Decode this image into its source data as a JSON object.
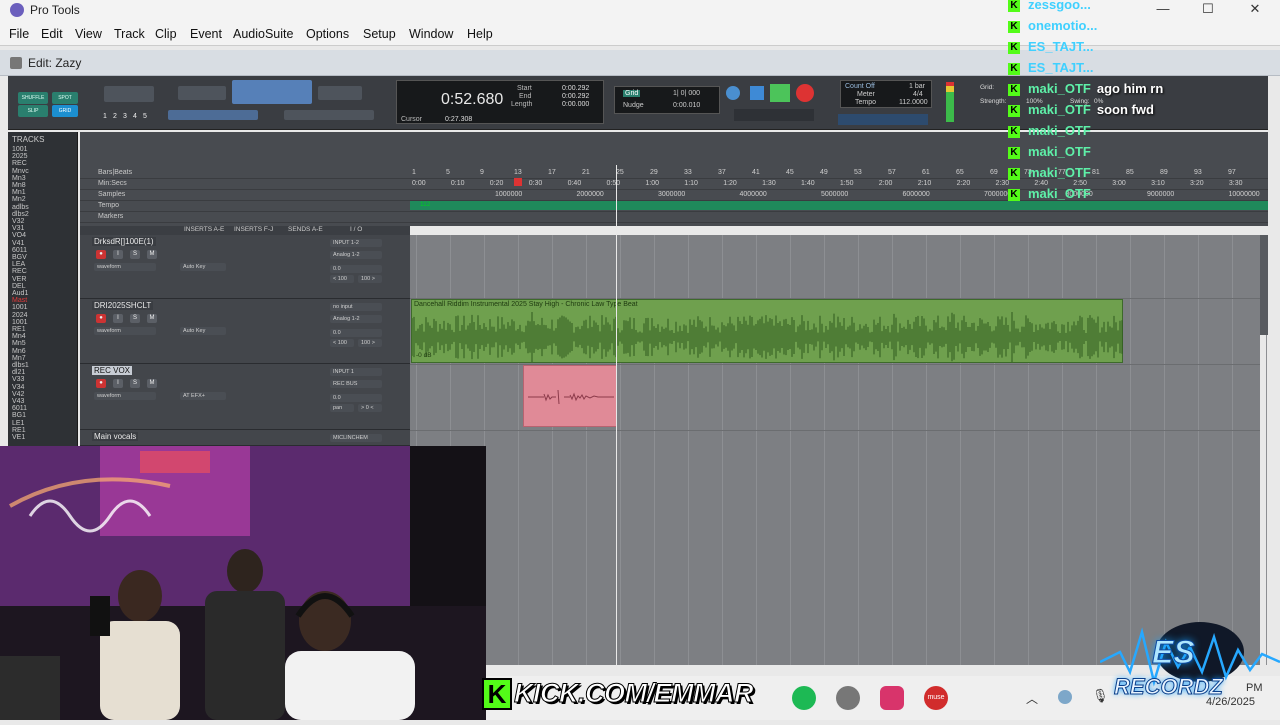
{
  "window": {
    "app_title": "Pro Tools",
    "edit_title": "Edit: Zazy",
    "controls": {
      "minimize": "—",
      "maximize": "☐",
      "close": "✕"
    }
  },
  "menu": [
    "File",
    "Edit",
    "View",
    "Track",
    "Clip",
    "Event",
    "AudioSuite",
    "Options",
    "Setup",
    "Window",
    "Help"
  ],
  "toolbar": {
    "modes": [
      "SHUFFLE",
      "SPOT",
      "SLIP",
      "GRID"
    ],
    "zoom_presets": [
      "1",
      "2",
      "3",
      "4",
      "5"
    ],
    "main_counter": "0:52.680",
    "start_label": "Start",
    "start_value": "0:00.292",
    "end_label": "End",
    "end_value": "0:00.292",
    "length_label": "Length",
    "length_value": "0:00.000",
    "cursor_label": "Cursor",
    "cursor_value": "0:27.308",
    "grid_label": "Grid",
    "grid_value": "1| 0| 000",
    "nudge_label": "Nudge",
    "nudge_value": "0:00.010",
    "count_off": "Count Off",
    "meter_label": "Meter",
    "meter_value": "4/4",
    "tempo_label": "Tempo",
    "tempo_value": "112.0000",
    "bar_value": "1 bar",
    "grid_right_label": "Grid:",
    "strength_label": "Strength:",
    "strength_value": "100%",
    "swing_label": "Swing:",
    "swing_value": "0%"
  },
  "tracklist": {
    "header": "TRACKS",
    "items": [
      {
        "name": "1001",
        "red": false
      },
      {
        "name": "2025",
        "red": false
      },
      {
        "name": "REC",
        "red": false
      },
      {
        "name": "Mnvc",
        "red": false
      },
      {
        "name": "Mn3",
        "red": false
      },
      {
        "name": "Mn8",
        "red": false
      },
      {
        "name": "Mn1",
        "red": false
      },
      {
        "name": "Mn2",
        "red": false
      },
      {
        "name": "adlbs",
        "red": false
      },
      {
        "name": "dlbs2",
        "red": false
      },
      {
        "name": "V32",
        "red": false
      },
      {
        "name": "V31",
        "red": false
      },
      {
        "name": "VO4",
        "red": false
      },
      {
        "name": "V41",
        "red": false
      },
      {
        "name": "6011",
        "red": false
      },
      {
        "name": "BGV",
        "red": false
      },
      {
        "name": "LEA",
        "red": false
      },
      {
        "name": "REC",
        "red": false
      },
      {
        "name": "VER",
        "red": false
      },
      {
        "name": "DEL",
        "red": false
      },
      {
        "name": "Aud1",
        "red": false
      },
      {
        "name": "Mast",
        "red": true
      },
      {
        "name": "1001",
        "red": false
      },
      {
        "name": "2024",
        "red": false
      },
      {
        "name": "1001",
        "red": false
      },
      {
        "name": "RE1",
        "red": false
      },
      {
        "name": "Mn4",
        "red": false
      },
      {
        "name": "Mn5",
        "red": false
      },
      {
        "name": "Mn6",
        "red": false
      },
      {
        "name": "Mn7",
        "red": false
      },
      {
        "name": "dlbs1",
        "red": false
      },
      {
        "name": "dl21",
        "red": false
      },
      {
        "name": "V33",
        "red": false
      },
      {
        "name": "V34",
        "red": false
      },
      {
        "name": "V42",
        "red": false
      },
      {
        "name": "V43",
        "red": false
      },
      {
        "name": "6011",
        "red": false
      },
      {
        "name": "BG1",
        "red": false
      },
      {
        "name": "LE1",
        "red": false
      },
      {
        "name": "RE1",
        "red": false
      },
      {
        "name": "VE1",
        "red": false
      }
    ]
  },
  "rulers": {
    "rows": [
      "Bars|Beats",
      "Min:Secs",
      "Samples",
      "Tempo",
      "Markers"
    ],
    "bars_ticks": [
      "1",
      "5",
      "9",
      "13",
      "17",
      "21",
      "25",
      "29",
      "33",
      "37",
      "41",
      "45",
      "49",
      "53",
      "57",
      "61",
      "65",
      "69",
      "73",
      "77",
      "81",
      "85",
      "89",
      "93",
      "97"
    ],
    "mins_ticks": [
      "0:00",
      "0:10",
      "0:20",
      "0:30",
      "0:40",
      "0:50",
      "1:00",
      "1:10",
      "1:20",
      "1:30",
      "1:40",
      "1:50",
      "2:00",
      "2:10",
      "2:20",
      "2:30",
      "2:40",
      "2:50",
      "3:00",
      "3:10",
      "3:20",
      "3:30"
    ],
    "samples_ticks": [
      "1000000",
      "2000000",
      "3000000",
      "4000000",
      "5000000",
      "6000000",
      "7000000",
      "8000000",
      "9000000",
      "10000000"
    ],
    "tempo_value": "112"
  },
  "columns": [
    "INSERTS A-E",
    "INSERTS F-J",
    "SENDS A-E",
    "I / O"
  ],
  "tracks": [
    {
      "name": "DrksdR[]100E(1)",
      "input": "INPUT 1-2",
      "output": "Analog 1-2",
      "view": "waveform",
      "auto": "Auto Key",
      "vol": "0.0",
      "pan_l": "< 100",
      "pan_r": "100 >",
      "selected": false
    },
    {
      "name": "DRI2025SHCLT",
      "input": "no input",
      "output": "Analog 1-2",
      "view": "waveform",
      "auto": "Auto Key",
      "vol": "0.0",
      "pan_l": "< 100",
      "pan_r": "100 >",
      "selected": false
    },
    {
      "name": "REC VOX",
      "input": "INPUT 1",
      "output": "REC BUS",
      "view": "waveform",
      "auto": "AT EFX+",
      "vol": "0.0",
      "pan_l": "pan",
      "pan_r": "> 0 <",
      "selected": true
    },
    {
      "name": "Main vocals",
      "input": "MICLINCHEM",
      "output": "",
      "view": "",
      "auto": "",
      "vol": "",
      "pan_l": "",
      "pan_r": "",
      "selected": false
    }
  ],
  "clips": {
    "beat_name": "Dancehall Riddim Instrumental 2025 Stay High - Chronic Law Type Beat",
    "beat_gain": "-0 dB"
  },
  "chat": [
    {
      "user": "zessgoo...",
      "msg": "",
      "color": "blue"
    },
    {
      "user": "onemotio...",
      "msg": "",
      "color": "blue"
    },
    {
      "user": "ES_TAJT...",
      "msg": "",
      "color": "blue"
    },
    {
      "user": "ES_TAJT...",
      "msg": "",
      "color": "blue"
    },
    {
      "user": "maki_OTF",
      "msg": "ago him rn",
      "color": "green"
    },
    {
      "user": "maki_OTF",
      "msg": "soon fwd",
      "color": "green"
    },
    {
      "user": "maki_OTF",
      "msg": "",
      "color": "green"
    },
    {
      "user": "maki_OTF",
      "msg": "",
      "color": "green"
    },
    {
      "user": "maki_OTF",
      "msg": "",
      "color": "green"
    },
    {
      "user": "maki_OTF",
      "msg": "",
      "color": "green"
    }
  ],
  "overlay": {
    "kick_text": "KICK.COM/EMMAR",
    "kick_badge": "K",
    "brand_top": "ES",
    "brand_bottom": "RECORDZ"
  },
  "taskbar": {
    "date": "4/26/2025",
    "time_suffix": "PM",
    "muse_label": "muse"
  }
}
